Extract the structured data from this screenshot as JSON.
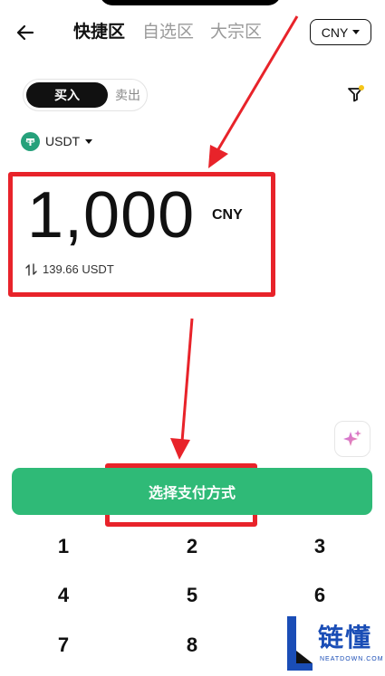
{
  "header": {
    "tabs": [
      {
        "label": "快捷区",
        "active": true
      },
      {
        "label": "自选区",
        "active": false
      },
      {
        "label": "大宗区",
        "active": false
      }
    ],
    "currency": "CNY",
    "back_icon": "arrow-left-icon",
    "currency_caret_icon": "caret-down-icon"
  },
  "trade_toggle": {
    "buy": "买入",
    "sell": "卖出"
  },
  "filter": {
    "icon": "filter-icon",
    "badge_color": "#f5c518"
  },
  "coin": {
    "name": "USDT",
    "icon": "tether-icon",
    "color": "#26a17b"
  },
  "amount": {
    "value": "1,000",
    "unit": "CNY",
    "converted": "139.66 USDT",
    "swap_icon": "swap-vertical-icon"
  },
  "ai_button": {
    "icon": "sparkle-icon"
  },
  "cta": {
    "label": "选择支付方式",
    "color": "#2fba77"
  },
  "keypad": {
    "keys": [
      "1",
      "2",
      "3",
      "4",
      "5",
      "6",
      "7",
      "8"
    ]
  },
  "watermark": {
    "text": "链懂",
    "sub": "NEATDOWN.COM"
  },
  "annotation_color": "#e8232a"
}
